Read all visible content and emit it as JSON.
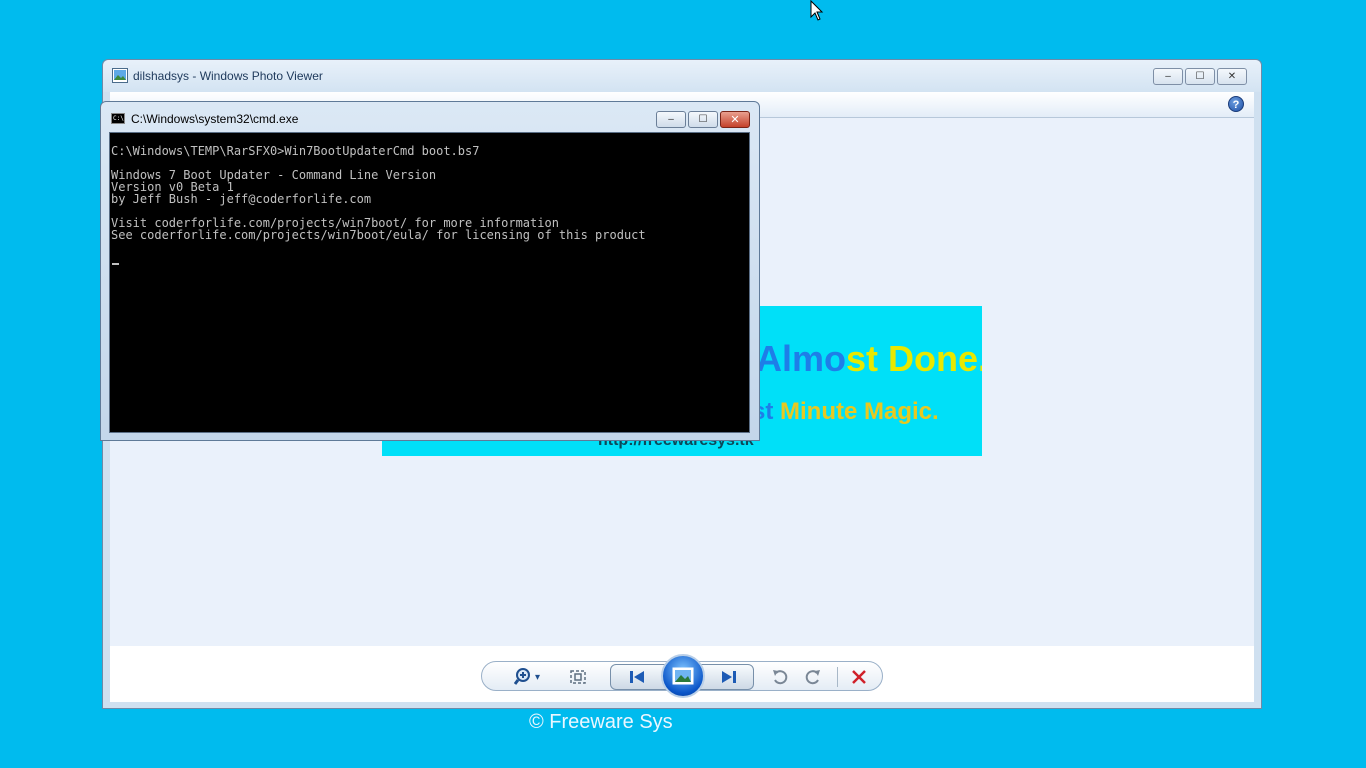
{
  "photo_viewer": {
    "title": "dilshadsys - Windows Photo Viewer",
    "window_buttons": {
      "minimize": "–",
      "maximize": "☐",
      "close": "✕"
    },
    "help_label": "?",
    "image": {
      "line1_a": "Almo",
      "line1_b": "st Done..",
      "line2_a": "st ",
      "line2_b": "Minute Magic.",
      "url": "http://freewaresys.tk"
    },
    "colors": {
      "text_blue": "#1e7ee8",
      "text_yellow": "#e8e800",
      "text_orange": "#e0c020"
    }
  },
  "cmd": {
    "title": "C:\\Windows\\system32\\cmd.exe",
    "icon_label": "C:\\",
    "buttons": {
      "minimize": "–",
      "maximize": "☐",
      "close": "✕"
    },
    "output": "C:\\Windows\\TEMP\\RarSFX0>Win7BootUpdaterCmd boot.bs7\n\nWindows 7 Boot Updater - Command Line Version\nVersion v0 Beta 1\nby Jeff Bush - jeff@coderforlife.com\n\nVisit coderforlife.com/projects/win7boot/ for more information\nSee coderforlife.com/projects/win7boot/eula/ for licensing of this product"
  },
  "controls": {
    "icons": [
      "zoom-icon",
      "actual-size-icon",
      "previous-icon",
      "slideshow-icon",
      "next-icon",
      "rotate-counterclockwise-icon",
      "rotate-clockwise-icon",
      "delete-icon"
    ],
    "dropdown_arrow": "▾"
  },
  "watermark": {
    "text": "©  Freeware Sys"
  }
}
